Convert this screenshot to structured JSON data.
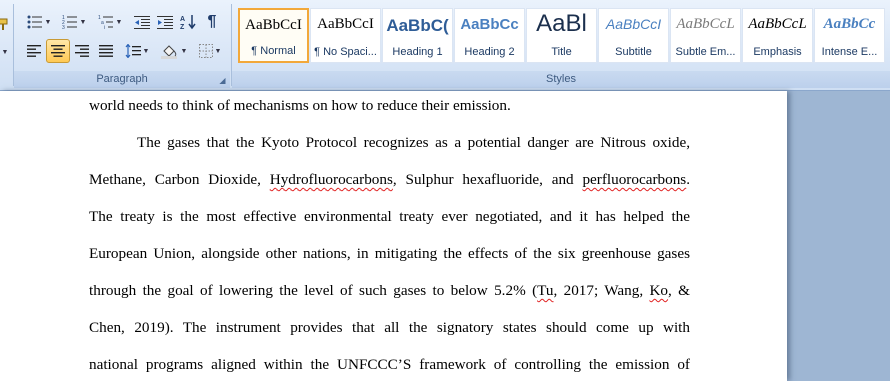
{
  "ribbon": {
    "paragraph_group": {
      "label": "Paragraph",
      "tooltip_launcher": "Paragraph settings"
    },
    "styles_group": {
      "label": "Styles",
      "styles": [
        {
          "sample": "AaBbCcI",
          "name": "¶ Normal",
          "selected": true
        },
        {
          "sample": "AaBbCcI",
          "name": "¶ No Spaci..."
        },
        {
          "sample": "AaBbC(",
          "name": "Heading 1"
        },
        {
          "sample": "AaBbCc",
          "name": "Heading 2"
        },
        {
          "sample": "AaBl",
          "name": "Title"
        },
        {
          "sample": "AaBbCcI",
          "name": "Subtitle"
        },
        {
          "sample": "AaBbCcL",
          "name": "Subtle Em..."
        },
        {
          "sample": "AaBbCcL",
          "name": "Emphasis"
        },
        {
          "sample": "AaBbCc",
          "name": "Intense E..."
        }
      ]
    }
  },
  "document": {
    "line0": "world needs to think of mechanisms on how to reduce their emission.",
    "p2_l1": "The gases that the Kyoto Protocol recognizes as a potential danger are Nitrous oxide,",
    "p2_l2a": "Methane, Carbon Dioxide, ",
    "p2_l2b": "Hydrofluorocarbons",
    "p2_l2c": ", Sulphur hexafluoride, and ",
    "p2_l2d": "perfluorocarbons",
    "p2_l2e": ".",
    "p2_l3": "The treaty is the most effective environmental treaty ever negotiated, and it has helped the",
    "p2_l4": "European Union, alongside other nations, in mitigating the effects of the six greenhouse gases",
    "p2_l5a": "through the goal of lowering the level of such gases to below 5.2% (",
    "p2_l5b": "Tu",
    "p2_l5c": ", 2017; Wang, ",
    "p2_l5d": "Ko",
    "p2_l5e": ", &",
    "p2_l6": "Chen, 2019). The instrument provides that all the signatory states should come up with",
    "p2_l7": "national programs aligned within the UNFCCC’S framework of controlling the emission of"
  }
}
